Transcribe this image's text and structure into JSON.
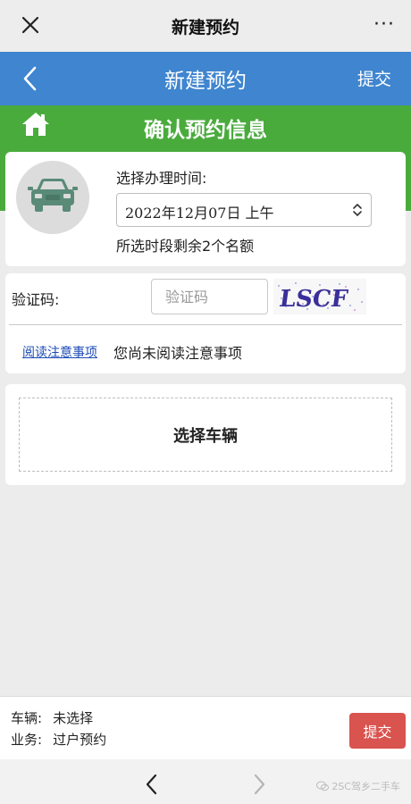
{
  "wechat_bar": {
    "title": "新建预约",
    "close_icon": "close-icon",
    "more_icon": "more-dots-icon",
    "more_glyph": "···"
  },
  "app_header": {
    "title": "新建预约",
    "submit_label": "提交",
    "back_icon": "chevron-left-icon",
    "background": "#3f85cf"
  },
  "section": {
    "title": "确认预约信息",
    "home_icon": "home-icon",
    "background": "#4aab3d"
  },
  "appointment": {
    "car_icon": "car-icon",
    "time_label": "选择办理时间:",
    "time_value": "2022年12月07日 上午",
    "quota_text": "所选时段剩余2个名额"
  },
  "captcha": {
    "label": "验证码:",
    "input_value": "",
    "input_placeholder": "验证码",
    "image_text": "LSCF"
  },
  "notice": {
    "link_label": "阅读注意事项",
    "status_text": "您尚未阅读注意事项"
  },
  "vehicle": {
    "select_label": "选择车辆"
  },
  "footer": {
    "vehicle_label": "车辆:",
    "vehicle_value": "未选择",
    "business_label": "业务:",
    "business_value": "过户预约",
    "submit_label": "提交",
    "submit_color": "#d9534f"
  },
  "bottom_nav": {
    "back_icon": "chevron-left-icon",
    "forward_icon": "chevron-right-icon",
    "watermark": "2SC驾乡二手车"
  }
}
